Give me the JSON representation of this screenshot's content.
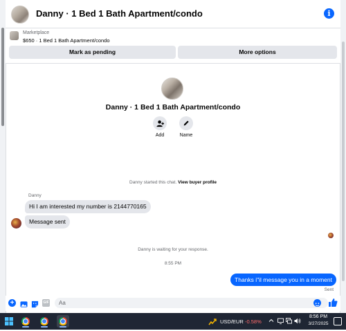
{
  "header": {
    "title": "Danny · 1 Bed 1 Bath Apartment/condo"
  },
  "listing": {
    "label": "Marketplace",
    "price_title": "$650 · 1 Bed 1 Bath Apartment/condo",
    "mark_pending": "Mark as pending",
    "more_options": "More options"
  },
  "profile": {
    "name": "Danny · 1 Bed 1 Bath Apartment/condo",
    "actions": [
      {
        "label": "Add",
        "icon": "add-person-icon"
      },
      {
        "label": "Name",
        "icon": "pencil-icon"
      }
    ]
  },
  "chat": {
    "system_started_prefix": "Danny started this chat.",
    "system_started_link": "View buyer profile",
    "sender": "Danny",
    "incoming": [
      "Hi I am interested my number is 2144770165",
      "Message sent"
    ],
    "waiting": "Danny is waiting for your response.",
    "timestamp": "8:55 PM",
    "outgoing": "Thanks i\"il message you in a moment",
    "status": "Sent"
  },
  "composer": {
    "placeholder": "Aa",
    "gif_label": "GIF"
  },
  "taskbar": {
    "fx_pair": "USD/EUR",
    "fx_change": "-0.58%",
    "time": "8:56 PM",
    "date": "3/27/2025"
  },
  "colors": {
    "accent": "#0866ff",
    "bubble_in": "#e4e6eb",
    "taskbar": "#1f2634",
    "negative": "#ff6b6b"
  }
}
